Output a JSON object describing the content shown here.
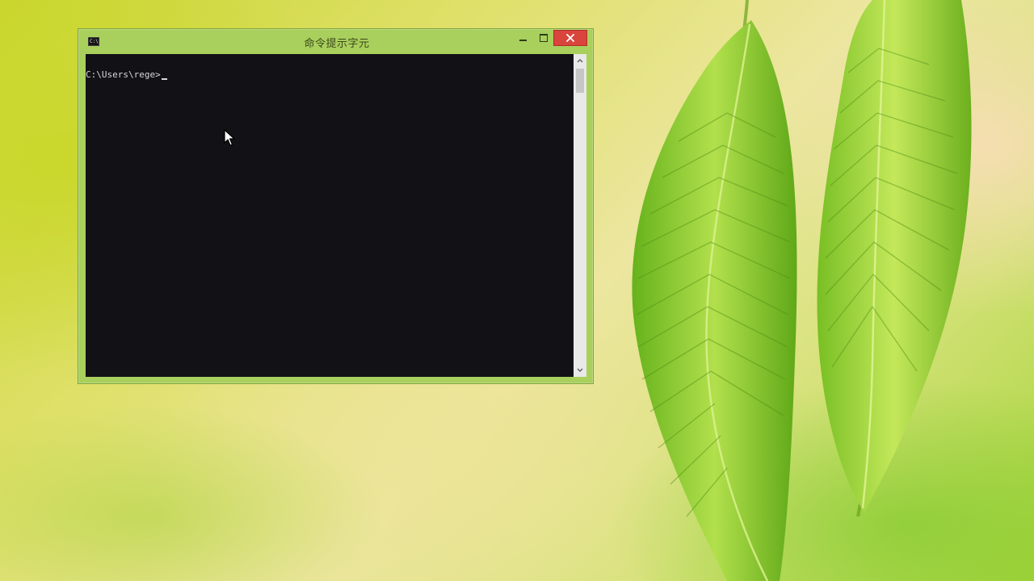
{
  "window": {
    "title": "命令提示字元",
    "app_icon_text": "C:\\",
    "buttons": {
      "minimize": "minimize",
      "maximize": "maximize",
      "close": "close"
    },
    "accent_color": "#a9cf5c",
    "close_color": "#d9443c"
  },
  "console": {
    "prompt": "C:\\Users\\rege>",
    "background_color": "#121116",
    "text_color": "#d8d8d8"
  },
  "icons": {
    "app": "console-icon",
    "minimize": "minimize-icon",
    "maximize": "maximize-icon",
    "close": "close-icon",
    "scroll_up": "chevron-up-icon",
    "scroll_down": "chevron-down-icon",
    "pointer": "mouse-pointer-icon"
  }
}
